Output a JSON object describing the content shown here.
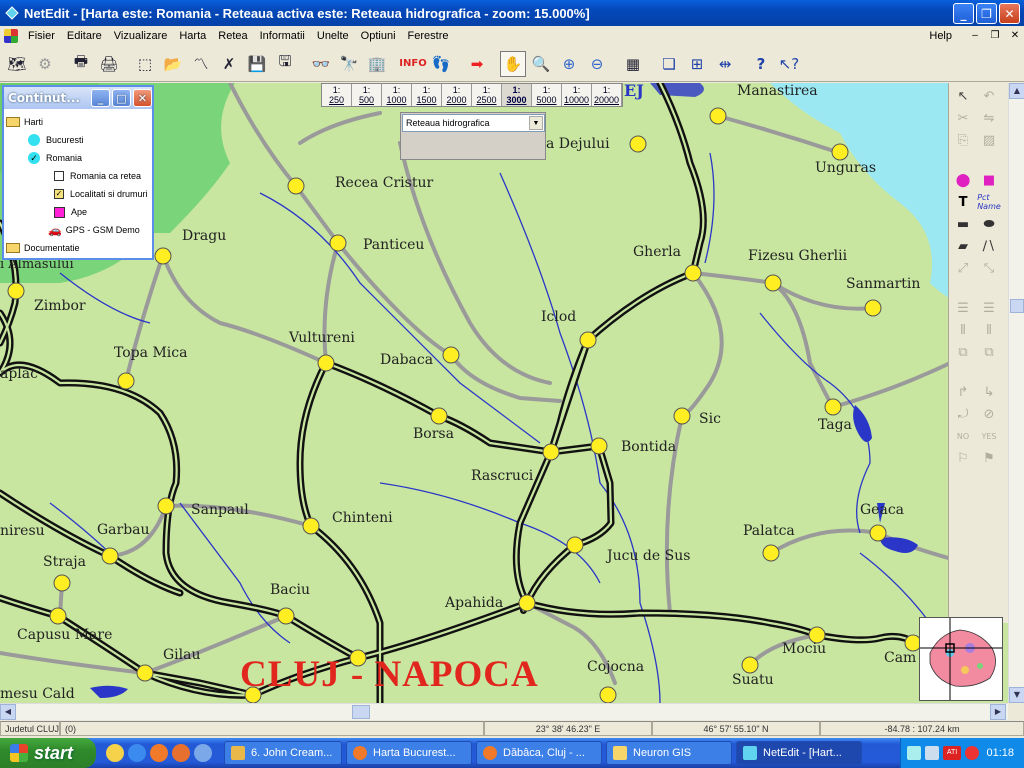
{
  "window": {
    "title": "NetEdit - [Harta este:  Romania - Reteaua activa este:  Reteaua hidrografica  - zoom: 15.000%]",
    "min": "_",
    "max": "❐",
    "close": "✕"
  },
  "menu": {
    "items": [
      "Fisier",
      "Editare",
      "Vizualizare",
      "Harta",
      "Retea",
      "Informatii",
      "Unelte",
      "Optiuni",
      "Ferestre"
    ],
    "help": "Help"
  },
  "toolbar": {
    "icons": [
      "map-open-icon",
      "map-tool-icon",
      "print-icon",
      "print-preview-icon",
      "select-region-icon",
      "open-folder-icon",
      "route-icon",
      "cross-route-icon",
      "save-icon",
      "save-as-icon",
      "binoculars-icon",
      "search-address-icon",
      "search-building-icon",
      "info-icon",
      "footprints-icon",
      "arrow-right-icon",
      "pan-hand-icon",
      "zoom-region-icon",
      "zoom-in-icon",
      "zoom-out-icon",
      "table-icon",
      "windows-cascade-icon",
      "windows-tile-icon",
      "fit-width-icon",
      "help-icon",
      "context-help-icon"
    ]
  },
  "scales": {
    "items": [
      {
        "top": "1:",
        "bottom": "250"
      },
      {
        "top": "1:",
        "bottom": "500"
      },
      {
        "top": "1:",
        "bottom": "1000"
      },
      {
        "top": "1:",
        "bottom": "1500"
      },
      {
        "top": "1:",
        "bottom": "2000"
      },
      {
        "top": "1:",
        "bottom": "2500"
      },
      {
        "top": "1:",
        "bottom": "3000"
      },
      {
        "top": "1:",
        "bottom": "5000"
      },
      {
        "top": "1:",
        "bottom": "10000"
      },
      {
        "top": "1:",
        "bottom": "20000"
      }
    ],
    "active_index": 6
  },
  "layer_select": {
    "value": "Reteaua hidrografica"
  },
  "floatwin": {
    "title": "Continut...",
    "tree": [
      {
        "label": "Harti",
        "kind": "folder",
        "level": 0
      },
      {
        "label": "Bucuresti",
        "kind": "dot",
        "level": 1
      },
      {
        "label": "Romania",
        "kind": "dot-check",
        "level": 1
      },
      {
        "label": "Romania ca retea",
        "kind": "checkbox",
        "checked": false,
        "level": 2
      },
      {
        "label": "Localitati si drumuri",
        "kind": "checkbox",
        "checked": true,
        "level": 2
      },
      {
        "label": "Ape",
        "kind": "magenta",
        "level": 2
      },
      {
        "label": "GPS - GSM Demo",
        "kind": "car",
        "level": 2
      },
      {
        "label": "Documentatie",
        "kind": "folder",
        "level": 0
      }
    ]
  },
  "map": {
    "city": "CLUJ - NAPOCA",
    "corner_label": "EJ",
    "towns": [
      {
        "name": "Manastirea"
      },
      {
        "name": "Unguras"
      },
      {
        "name": "a Dejului"
      },
      {
        "name": "Recea Cristur"
      },
      {
        "name": "Dragu"
      },
      {
        "name": "Panticeu"
      },
      {
        "name": "Gherla"
      },
      {
        "name": "Fizesu Gherlii"
      },
      {
        "name": "Sanmartin"
      },
      {
        "name": "ı Almasului"
      },
      {
        "name": "Zimbor"
      },
      {
        "name": "Iclod"
      },
      {
        "name": "Vultureni"
      },
      {
        "name": "Topa  Mica"
      },
      {
        "name": "Dabaca"
      },
      {
        "name": "aplac"
      },
      {
        "name": "Sic"
      },
      {
        "name": "Taga"
      },
      {
        "name": "Borsa"
      },
      {
        "name": "Bontida"
      },
      {
        "name": "Rascruci"
      },
      {
        "name": "Sanpaul"
      },
      {
        "name": "Chinteni"
      },
      {
        "name": "Gherla"
      },
      {
        "name": "Garbau"
      },
      {
        "name": "niresu"
      },
      {
        "name": "Palatca"
      },
      {
        "name": "Geaca"
      },
      {
        "name": "Jucu de Sus"
      },
      {
        "name": "Straja"
      },
      {
        "name": "Baciu"
      },
      {
        "name": "Apahida"
      },
      {
        "name": "Capusu Mare"
      },
      {
        "name": "Gilau"
      },
      {
        "name": "Mociu"
      },
      {
        "name": "Cam"
      },
      {
        "name": "Cojocna"
      },
      {
        "name": "Suatu"
      },
      {
        "name": "mesu Cald"
      }
    ]
  },
  "statusbar": {
    "county": "Judetul CLUJ",
    "count": "(0)",
    "lon": "23° 38' 46.23\" E",
    "lat": "46° 57' 55.10\" N",
    "dist": "-84.78 : 107.24 km"
  },
  "taskbar": {
    "start": "start",
    "tasks": [
      "6. John Cream...",
      "Harta Bucurest...",
      "Dăbâca, Cluj - ...",
      "Neuron GIS",
      "NetEdit - [Hart..."
    ],
    "clock": "01:18",
    "tray_ati": "ATI"
  },
  "colors": {
    "land": "#c8e6a0",
    "forest": "#7ad47a",
    "water": "#9be8f2",
    "road_major": "#111111",
    "road_minor": "#a0a0a0",
    "river": "#2a36c8",
    "town": "#ffee22",
    "city_label": "#e0261d"
  }
}
